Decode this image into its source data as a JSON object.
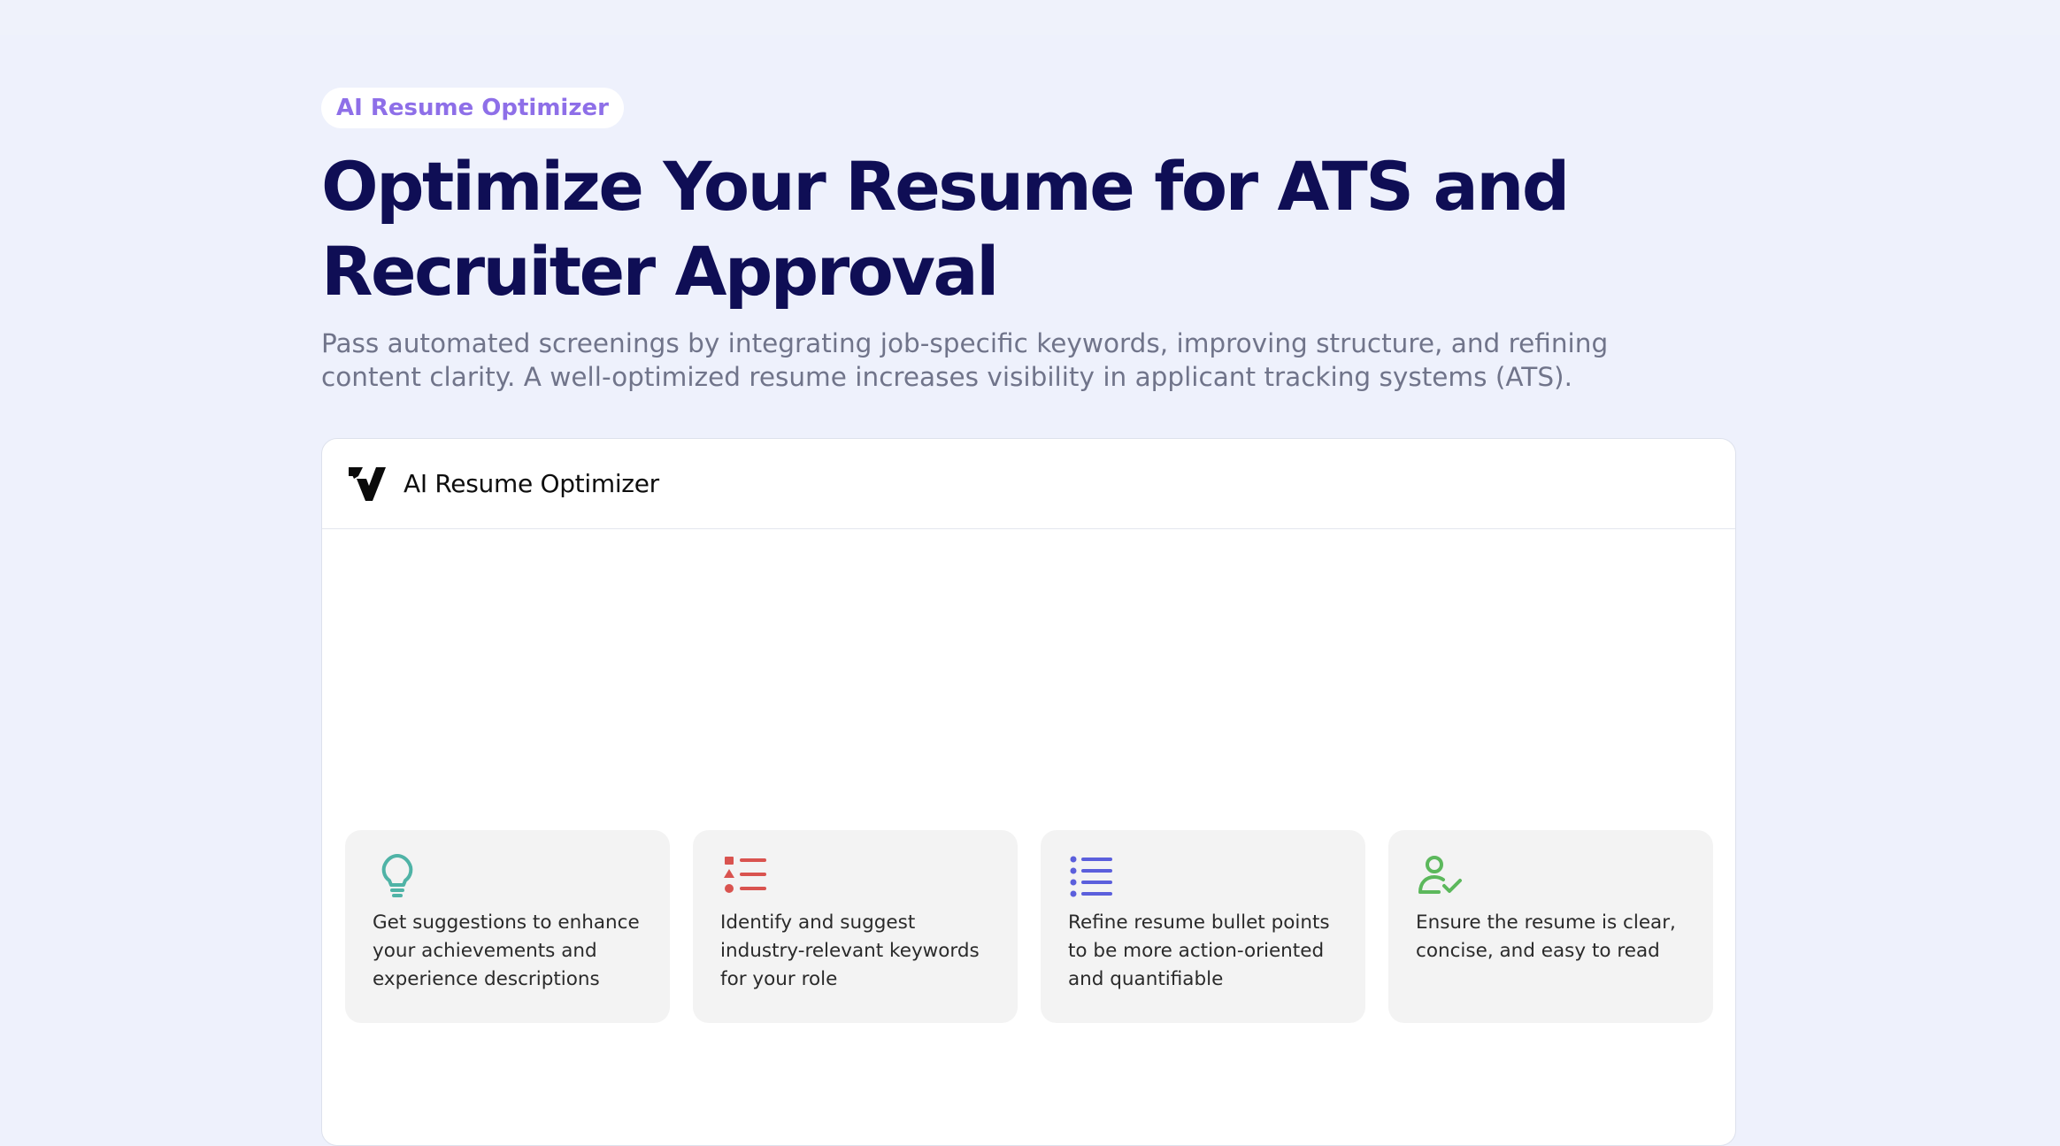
{
  "hero": {
    "badge": "AI Resume Optimizer",
    "title": "Optimize Your Resume for ATS and Recruiter Approval",
    "subtitle": "Pass automated screenings by integrating job-specific keywords, improving structure, and refining content clarity. A well-optimized resume increases visibility in applicant tracking systems (ATS)."
  },
  "app": {
    "title": "AI Resume Optimizer",
    "logo_icon": "v-logo-icon"
  },
  "cards": [
    {
      "icon": "lightbulb-icon",
      "color": "#4fb3a6",
      "text": "Get suggestions to enhance your achievements and experience descriptions"
    },
    {
      "icon": "list-shapes-icon",
      "color": "#d9534f",
      "text": "Identify and suggest industry-relevant keywords for your role"
    },
    {
      "icon": "bullet-list-icon",
      "color": "#5b5fdc",
      "text": "Refine resume bullet points to be more action-oriented and quantifiable"
    },
    {
      "icon": "user-check-icon",
      "color": "#5cb85c",
      "text": "Ensure the resume is clear, concise, and easy to read"
    }
  ],
  "colors": {
    "page_background": "#eef1fc",
    "badge_text": "#8e6fe8",
    "title_text": "#0f0e55",
    "subtitle_text": "#70748a"
  }
}
